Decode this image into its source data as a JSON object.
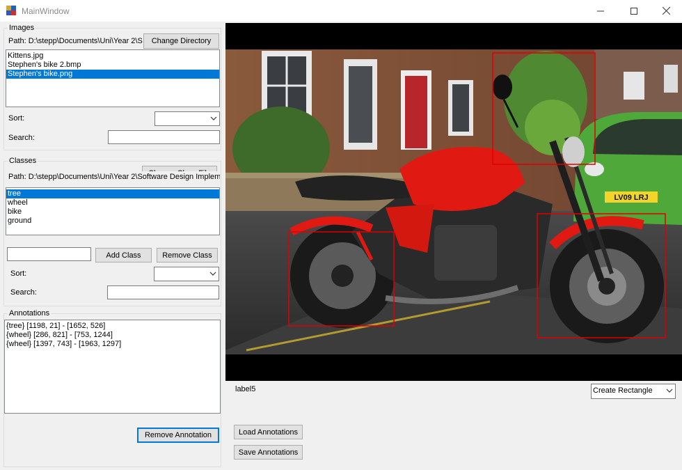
{
  "window": {
    "title": "MainWindow"
  },
  "images_group": {
    "legend": "Images",
    "path_label": "Path: D:\\stepp\\Documents\\Uni\\Year 2\\S",
    "change_directory_label": "Change Directory",
    "files": [
      "Kittens.jpg",
      "Stephen's bike 2.bmp",
      "Stephen's bike.png"
    ],
    "selected_index": 2,
    "sort_label": "Sort:",
    "sort_value": "",
    "search_label": "Search:",
    "search_value": ""
  },
  "classes_group": {
    "legend": "Classes",
    "path_label": "Path: D:\\stepp\\Documents\\Uni\\Year 2\\Software Design  Implem",
    "change_file_label": "Change Class File",
    "classes": [
      "tree",
      "wheel",
      "bike",
      "ground"
    ],
    "selected_index": 0,
    "new_class_value": "",
    "add_class_label": "Add Class",
    "remove_class_label": "Remove Class",
    "sort_label": "Sort:",
    "sort_value": "",
    "search_label": "Search:",
    "search_value": ""
  },
  "annotations_group": {
    "legend": "Annotations",
    "items": [
      "{tree} [1198, 21] - [1652, 526]",
      "{wheel} [286, 821] - [753, 1244]",
      "{wheel} [1397, 743] - [1963, 1297]"
    ],
    "remove_annotation_label": "Remove Annotation"
  },
  "image_view": {
    "status_label": "label5",
    "tool_value": "Create Rectangle",
    "annotation_color": "#e00000",
    "plate_text": "LV09 LRJ"
  },
  "actions": {
    "load_label": "Load Annotations",
    "save_label": "Save Annotations"
  },
  "colors": {
    "selection": "#0078d7",
    "bike_red": "#e01a12",
    "car_green": "#4ea83a"
  }
}
